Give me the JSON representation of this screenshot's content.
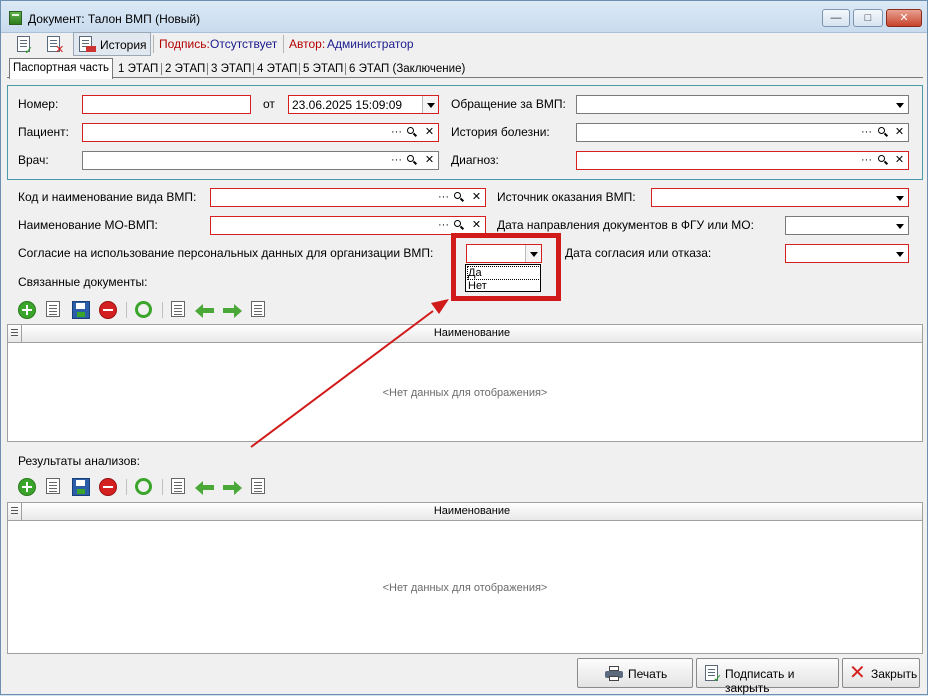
{
  "window": {
    "title": "Документ: Талон ВМП (Новый)",
    "buttons": {
      "minimize": "—",
      "maximize": "□",
      "close": "✕"
    }
  },
  "toolbar": {
    "history_label": "История",
    "signature_label": "Подпись:",
    "signature_value": "Отсутствует",
    "author_label": "Автор:",
    "author_value": "Администратор"
  },
  "tabs": [
    {
      "label": "Паспортная часть",
      "active": true
    },
    {
      "label": "1 ЭТАП"
    },
    {
      "label": "2 ЭТАП"
    },
    {
      "label": "3 ЭТАП"
    },
    {
      "label": "4 ЭТАП"
    },
    {
      "label": "5 ЭТАП"
    },
    {
      "label": "6 ЭТАП (Заключение)"
    }
  ],
  "form": {
    "number_label": "Номер:",
    "number_value": "",
    "from_label": "от",
    "date_value": "23.06.2025 15:09:09",
    "appeal_label": "Обращение за ВМП:",
    "patient_label": "Пациент:",
    "history_label": "История болезни:",
    "doctor_label": "Врач:",
    "diagnosis_label": "Диагноз:",
    "vmp_code_label": "Код и наименование вида ВМП:",
    "vmp_source_label": "Источник оказания ВМП:",
    "mo_name_label": "Наименование МО-ВМП:",
    "docs_date_label": "Дата направления документов в ФГУ или МО:",
    "consent_label": "Согласие на использование персональных данных для организации ВМП:",
    "consent_date_label": "Дата согласия или отказа:",
    "field_btn_dots": "···",
    "field_btn_clear": "✕"
  },
  "consent_dropdown": {
    "value": "",
    "options": [
      "Да",
      "Нет"
    ]
  },
  "linked_docs": {
    "title": "Связанные документы:",
    "column": "Наименование",
    "empty": "<Нет данных для отображения>"
  },
  "analysis_results": {
    "title": "Результаты анализов:",
    "column": "Наименование",
    "empty": "<Нет данных для отображения>"
  },
  "bottom_buttons": {
    "print": "Печать",
    "sign_close": "Подписать и закрыть",
    "close": "Закрыть"
  },
  "colors": {
    "required_border": "#d42020",
    "highlight": "#d11a1a",
    "group_border": "#4a9aa8"
  }
}
